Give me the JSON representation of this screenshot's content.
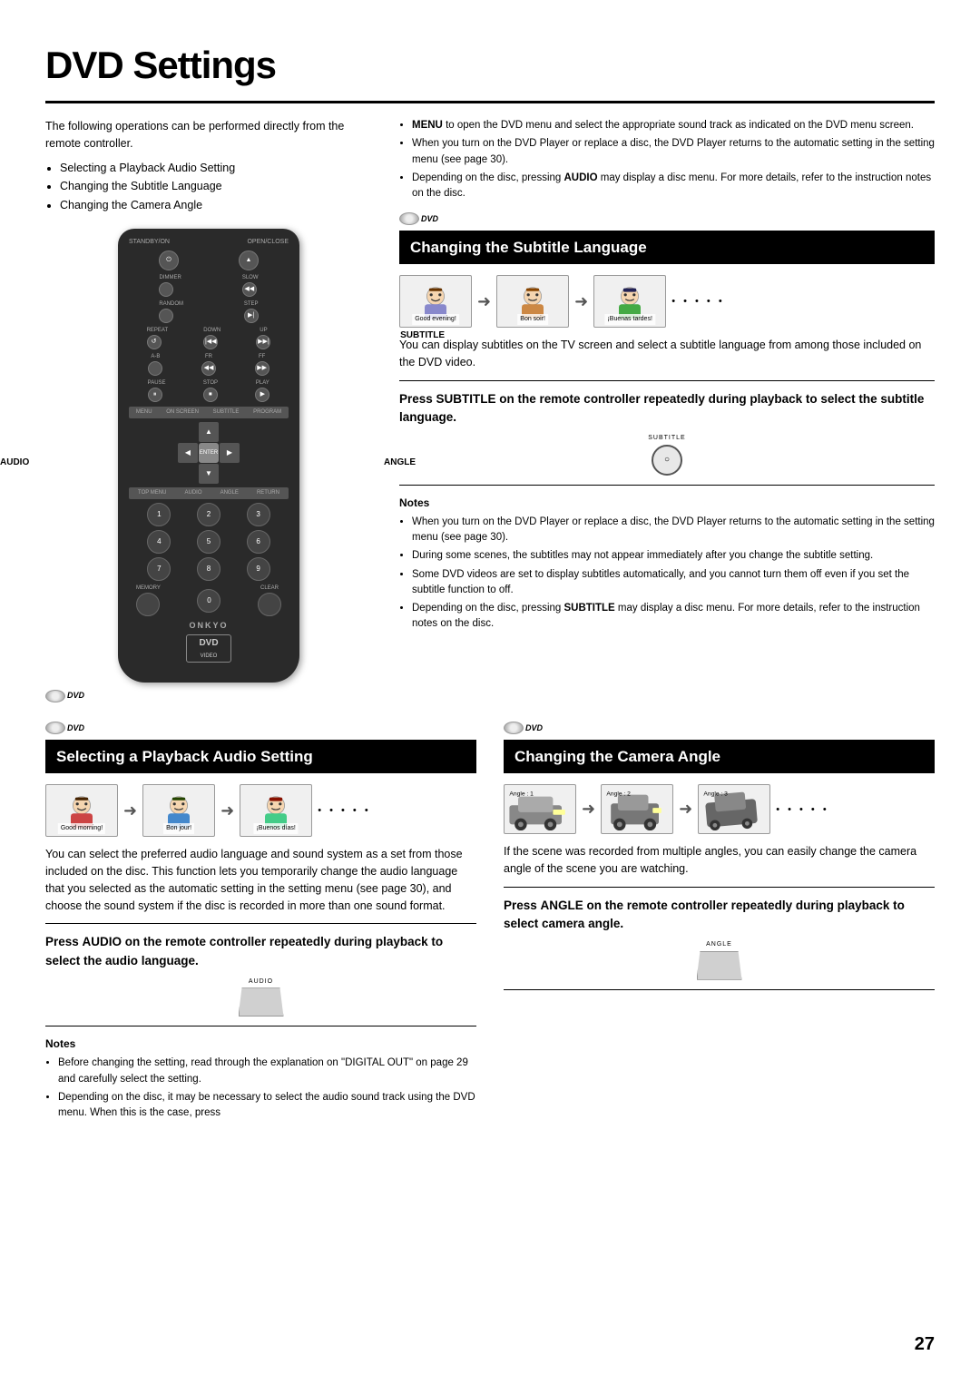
{
  "page": {
    "title": "DVD Settings",
    "number": "27"
  },
  "intro": {
    "text": "The following operations can be performed directly from the remote controller.",
    "bullets": [
      "Selecting a Playback Audio Setting",
      "Changing the Subtitle Language",
      "Changing the Camera Angle"
    ]
  },
  "right_intro_notes": [
    "MENU to open the DVD menu and select the appropriate sound track as indicated on the DVD menu screen.",
    "When you turn on the DVD Player or replace a disc, the DVD Player returns to the automatic setting in the setting menu (see page 30).",
    "Depending on the disc, pressing AUDIO may display a disc menu. For more details, refer to the instruction notes on the disc."
  ],
  "remote_labels": {
    "subtitle": "SUBTITLE",
    "audio": "AUDIO",
    "angle": "ANGLE"
  },
  "sections": {
    "subtitle_language": {
      "title": "Changing the Subtitle Language",
      "description": "You can display subtitles on the TV screen and select a subtitle language from among those included on the DVD video.",
      "instruction": "Press SUBTITLE on the remote controller repeatedly during playback to select the subtitle language.",
      "illustrations": [
        {
          "caption": "Good evening!"
        },
        {
          "caption": "Bon soir!"
        },
        {
          "caption": "¡Buenas tardes!"
        }
      ],
      "notes": [
        "When you turn on the DVD Player or replace a disc, the DVD Player returns to the automatic setting in the setting menu (see page 30).",
        "During some scenes, the subtitles may not appear immediately after you change the subtitle setting.",
        "Some DVD videos are set to display subtitles automatically, and you cannot turn them off even if you set the subtitle function to off.",
        "Depending on the disc, pressing SUBTITLE may display a disc menu. For more details, refer to the instruction notes on the disc."
      ]
    },
    "audio_setting": {
      "title": "Selecting a Playback Audio Setting",
      "description": "You can select the preferred audio language and sound system as a set from those included on the disc. This function lets you temporarily change the audio language that you selected as the automatic setting in the setting menu (see page 30), and choose the sound system if the disc is recorded in more than one sound format.",
      "instruction": "Press AUDIO on the remote controller repeatedly during playback to select the audio language.",
      "illustrations": [
        {
          "caption": "Good morning!"
        },
        {
          "caption": "Bon jour!"
        },
        {
          "caption": "¡Buenos días!"
        }
      ],
      "notes": [
        "Before changing the setting, read through the explanation on \"DIGITAL OUT\" on page 29 and carefully select the setting.",
        "Depending on the disc, it may be necessary to select the audio sound track using the DVD menu. When this is the case, press"
      ]
    },
    "camera_angle": {
      "title": "Changing the Camera Angle",
      "description": "If the scene was recorded from multiple angles, you can easily change the camera angle of the scene you are watching.",
      "instruction": "Press ANGLE on the remote controller repeatedly during playback to select camera angle.",
      "illustrations": [
        {
          "caption": "Angle : 1"
        },
        {
          "caption": "Angle : 2"
        },
        {
          "caption": "Angle : 3"
        }
      ],
      "notes": []
    }
  }
}
